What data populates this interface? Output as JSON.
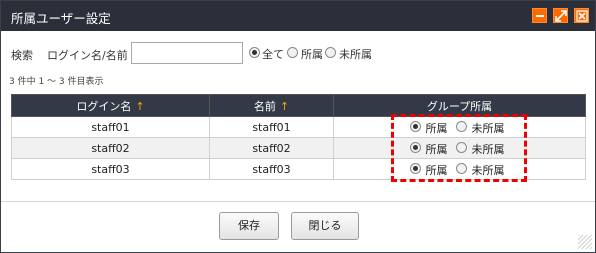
{
  "dialog": {
    "title": "所属ユーザー設定",
    "minimize_icon": "minimize-icon",
    "maximize_icon": "maximize-icon",
    "close_icon": "close-icon",
    "accent_color": "#ff6a00"
  },
  "search": {
    "label": "検索",
    "field_label": "ログイン名/名前",
    "value": "",
    "placeholder": "",
    "filter_options": [
      "全て",
      "所属",
      "未所属"
    ],
    "selected_filter": "全て"
  },
  "result_count": "3 件中 1 ～ 3 件目表示",
  "table": {
    "columns": [
      "ログイン名",
      "名前",
      "グループ所属"
    ],
    "sort_icon": "↑",
    "membership_options": [
      "所属",
      "未所属"
    ],
    "rows": [
      {
        "login": "staff01",
        "name": "staff01",
        "membership": "所属"
      },
      {
        "login": "staff02",
        "name": "staff02",
        "membership": "所属"
      },
      {
        "login": "staff03",
        "name": "staff03",
        "membership": "所属"
      }
    ]
  },
  "buttons": {
    "save": "保存",
    "close": "閉じる"
  }
}
